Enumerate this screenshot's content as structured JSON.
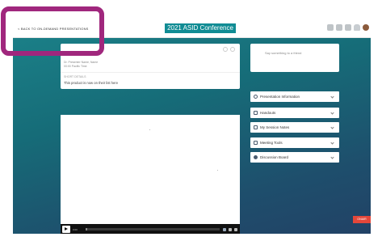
{
  "topbar": {
    "back_label": "< BACK TO ON-DEMAND PRESENTATIONS",
    "conference_title": "2021 ASID Conference",
    "icons": [
      "participants-icon",
      "chat-icon",
      "agenda-icon",
      "notifications-icon",
      "user-avatar"
    ]
  },
  "session": {
    "speakers_line1": "Dr. Presenter Name, Name",
    "speakers_line2": "00:00 Pacific Time",
    "short_label": "Short Details",
    "description": "This product is now on their list here"
  },
  "chat": {
    "placeholder": "Say something to a friend"
  },
  "accordion": [
    {
      "label": "Presentation Information",
      "icon": "info-icon"
    },
    {
      "label": "Handouts",
      "icon": "document-icon"
    },
    {
      "label": "My Session Notes",
      "icon": "notes-icon"
    },
    {
      "label": "Meeting Tools",
      "icon": "tools-icon"
    },
    {
      "label": "Discussion Board",
      "icon": "discussion-icon"
    }
  ],
  "video": {
    "time": "0:00",
    "progress": 0.01
  },
  "badge": {
    "label": "ONAIR"
  },
  "colors": {
    "accent_teal": "#118c94",
    "highlight_magenta": "#a0277d",
    "badge_red": "#e4473a"
  }
}
